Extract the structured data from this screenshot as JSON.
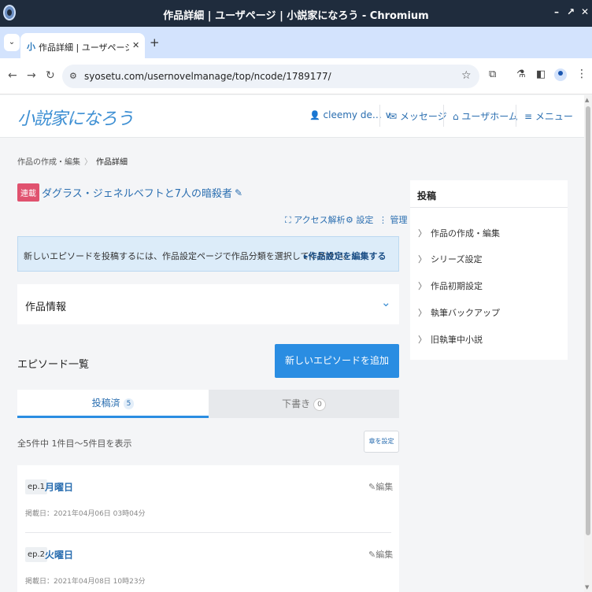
{
  "window": {
    "title": "作品詳細 | ユーザページ | 小説家になろう - Chromium",
    "minimize": "–",
    "maximize": "↗",
    "close": "✕"
  },
  "browser": {
    "tab_menu_glyph": "⌄",
    "tab": {
      "favicon": "小",
      "title": "作品詳細 | ユーザページ | 小",
      "close": "✕"
    },
    "new_tab": "+",
    "back": "←",
    "forward": "→",
    "reload": "↻",
    "site_info_glyph": "⚙",
    "url": "syosetu.com/usernovelmanage/top/ncode/1789177/",
    "bookmark_glyph": "☆",
    "extensions_glyph": "⧉",
    "labs_glyph": "⚗",
    "sidepanel_glyph": "◧",
    "menu_glyph": "⋮"
  },
  "header": {
    "logo": "小説家になろう",
    "user_name": "cleemy de… ∨",
    "messages": "✉ メッセージ",
    "user_home": "⌂ ユーザホーム",
    "menu": "≡ メニュー"
  },
  "breadcrumb": {
    "parent": "作品の作成・編集",
    "separator": "〉",
    "current": "作品詳細"
  },
  "novel": {
    "badge": "連載",
    "title": "ダグラス・ジェネルベフトと7人の暗殺者",
    "edit_glyph": "✎"
  },
  "actions": {
    "analytics": "⛶ アクセス解析",
    "settings": "⚙ 設定",
    "manage": "⋮ 管理"
  },
  "notice": {
    "text": "新しいエピソードを投稿するには、作品設定ページで作品分類を選択してください。",
    "link": "▸作品設定を編集する"
  },
  "info": {
    "label": "作品情報",
    "chevron": "⌄"
  },
  "episodes": {
    "heading": "エピソード一覧",
    "add_button": "新しいエピソードを追加",
    "tabs": {
      "published_label": "投稿済",
      "published_count": "5",
      "draft_label": "下書き",
      "draft_count": "0"
    },
    "range_text": "全5件中 1件目〜5件目を表示",
    "chapter_button": "章を設定",
    "items": [
      {
        "num": "ep.1",
        "title": "月曜日",
        "edit": "✎編集",
        "date": "掲載日：2021年04月06日 03時04分"
      },
      {
        "num": "ep.2",
        "title": "火曜日",
        "edit": "✎編集",
        "date": "掲載日：2021年04月08日 10時23分"
      }
    ]
  },
  "sidebar": {
    "heading": "投稿",
    "arrow": "〉",
    "items": [
      {
        "label": "作品の作成・編集"
      },
      {
        "label": "シリーズ設定"
      },
      {
        "label": "作品初期設定"
      },
      {
        "label": "執筆バックアップ"
      },
      {
        "label": "旧執筆中小説"
      }
    ]
  },
  "colors": {
    "accent": "#2a8de2",
    "link": "#2a6eb0",
    "badge": "#e0526f",
    "notice_bg": "#dcecf9"
  }
}
